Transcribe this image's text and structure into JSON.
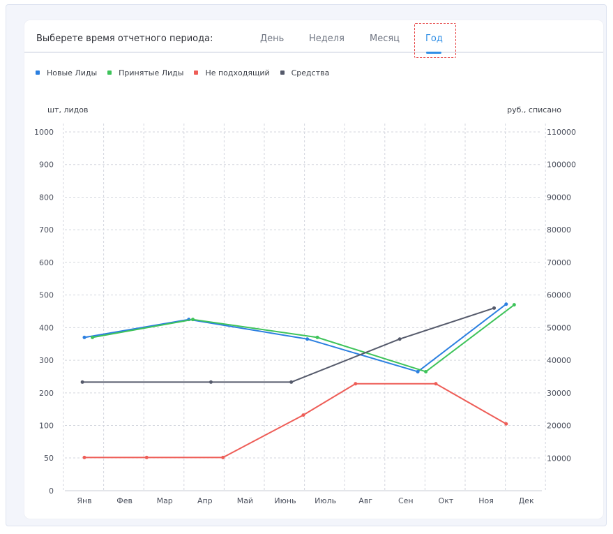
{
  "period": {
    "label": "Выберете время отчетного периода:",
    "tabs": [
      {
        "label": "День"
      },
      {
        "label": "Неделя"
      },
      {
        "label": "Месяц"
      },
      {
        "label": "Год"
      }
    ],
    "active_tab": "Год"
  },
  "chart_data": {
    "type": "line",
    "left_axis_label": "шт, лидов",
    "right_axis_label": "руб., списано",
    "left_ticks": [
      1000,
      900,
      800,
      700,
      600,
      500,
      400,
      300,
      200,
      100,
      50,
      0
    ],
    "right_ticks": [
      110000,
      100000,
      90000,
      80000,
      70000,
      60000,
      50000,
      40000,
      30000,
      20000,
      10000
    ],
    "categories": [
      "Янв",
      "Фев",
      "Мар",
      "Апр",
      "Май",
      "Июнь",
      "Июль",
      "Авг",
      "Сен",
      "Окт",
      "Ноя",
      "Дек"
    ],
    "grid": true,
    "legend_position": "top-left",
    "series": [
      {
        "name": "Новые Лиды",
        "color": "#2b7fe0",
        "axis": "left",
        "points": [
          [
            0,
            470
          ],
          [
            2.6,
            525
          ],
          [
            5.55,
            465
          ],
          [
            8.3,
            365
          ],
          [
            10.5,
            572
          ]
        ]
      },
      {
        "name": "Принятые Лиды",
        "color": "#3ec35a",
        "axis": "left",
        "points": [
          [
            0.2,
            470
          ],
          [
            2.7,
            525
          ],
          [
            5.8,
            470
          ],
          [
            8.5,
            365
          ],
          [
            10.7,
            570
          ]
        ]
      },
      {
        "name": "Не подходящий",
        "color": "#ee5d57",
        "axis": "left",
        "points": [
          [
            0,
            102
          ],
          [
            1.55,
            102
          ],
          [
            3.45,
            102
          ],
          [
            5.45,
            232
          ],
          [
            6.75,
            328
          ],
          [
            8.75,
            328
          ],
          [
            10.5,
            205
          ]
        ]
      },
      {
        "name": "Средства",
        "color": "#555a6b",
        "axis": "left",
        "points": [
          [
            -0.05,
            333
          ],
          [
            3.15,
            333
          ],
          [
            5.15,
            333
          ],
          [
            7.85,
            465
          ],
          [
            10.2,
            560
          ]
        ]
      }
    ]
  }
}
